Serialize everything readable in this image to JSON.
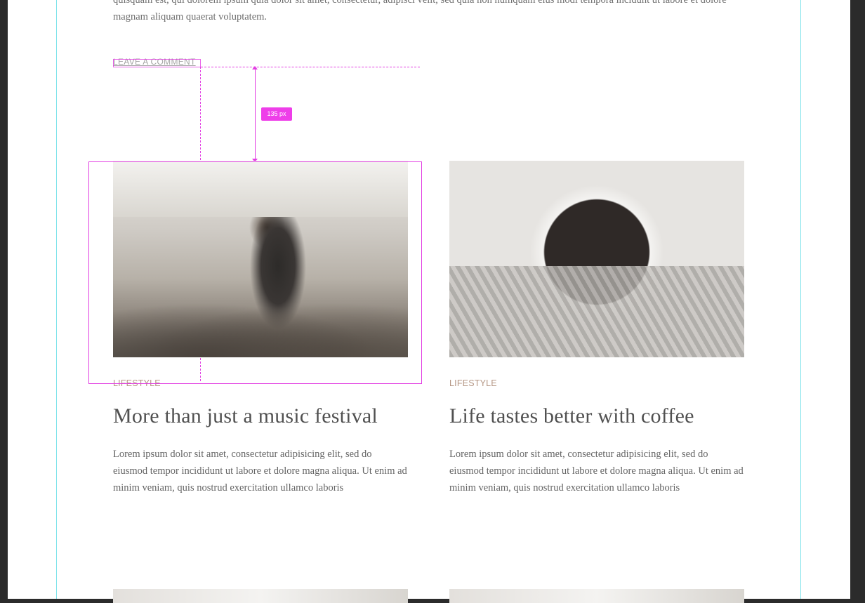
{
  "intro": {
    "text": "quisquam est, qui dolorem ipsum quia dolor sit amet, consectetur, adipisci velit, sed quia non numquam eius modi tempora incidunt ut labore et dolore magnam aliquam quaerat voluptatem."
  },
  "leave_comment": "LEAVE A COMMENT",
  "measurement": {
    "label": "135 px",
    "color": "#ee3ee9"
  },
  "guide_color": "#7fe3ea",
  "cards": [
    {
      "image_alt": "festival crowd photo",
      "category": "LIFESTYLE",
      "title": "More than just a music festival",
      "excerpt": "Lorem ipsum dolor sit amet, consectetur adipisicing elit, sed do eiusmod tempor incididunt ut labore et dolore magna aliqua. Ut enim ad minim veniam, quis nostrud exercitation ullamco laboris"
    },
    {
      "image_alt": "coffee cup in mittens photo",
      "category": "LIFESTYLE",
      "title": "Life tastes better with coffee",
      "excerpt": "Lorem ipsum dolor sit amet, consectetur adipisicing elit, sed do eiusmod tempor incididunt ut labore et dolore magna aliqua. Ut enim ad minim veniam, quis nostrud exercitation ullamco laboris"
    }
  ]
}
